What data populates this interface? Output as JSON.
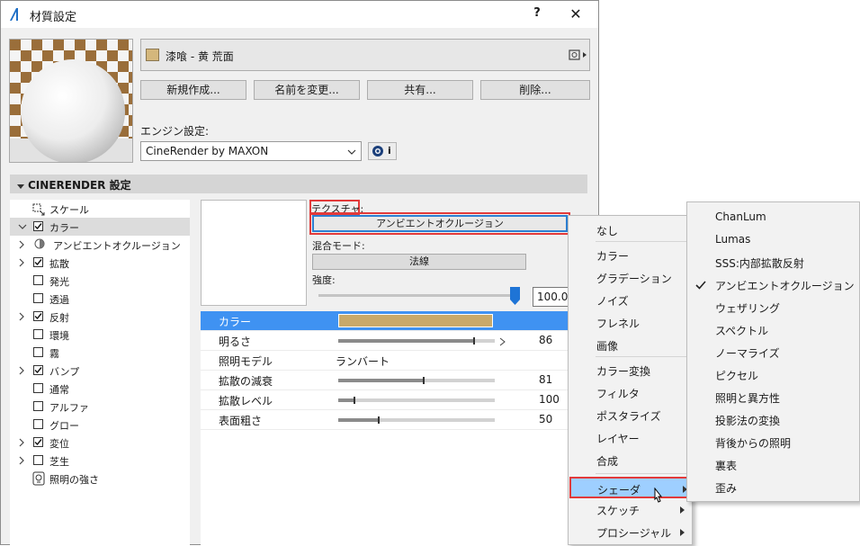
{
  "window": {
    "title": "材質設定",
    "help": "?",
    "close": "✕"
  },
  "material": {
    "name": "漆喰 - 黄 荒面",
    "swatch_color": "#d4b77c"
  },
  "buttons": {
    "new": "新規作成...",
    "rename": "名前を変更...",
    "share": "共有...",
    "delete": "削除..."
  },
  "engine": {
    "label": "エンジン設定:",
    "value": "CineRender by MAXON",
    "info": "i"
  },
  "section": {
    "title": "CINERENDER 設定"
  },
  "channels": [
    {
      "label": "スケール",
      "kind": "scale-icon"
    },
    {
      "label": "カラー",
      "kind": "checkbox",
      "checked": true,
      "expand": "open"
    },
    {
      "label": "アンビエントオクルージョン",
      "kind": "radio",
      "expand": "closed"
    },
    {
      "label": "拡散",
      "kind": "checkbox",
      "checked": true,
      "expand": "closed"
    },
    {
      "label": "発光",
      "kind": "checkbox",
      "checked": false
    },
    {
      "label": "透過",
      "kind": "checkbox",
      "checked": false
    },
    {
      "label": "反射",
      "kind": "checkbox",
      "checked": true,
      "expand": "closed"
    },
    {
      "label": "環境",
      "kind": "checkbox",
      "checked": false
    },
    {
      "label": "霧",
      "kind": "checkbox",
      "checked": false
    },
    {
      "label": "バンプ",
      "kind": "checkbox",
      "checked": true,
      "expand": "closed"
    },
    {
      "label": "通常",
      "kind": "checkbox",
      "checked": false
    },
    {
      "label": "アルファ",
      "kind": "checkbox",
      "checked": false
    },
    {
      "label": "グロー",
      "kind": "checkbox",
      "checked": false
    },
    {
      "label": "変位",
      "kind": "checkbox",
      "checked": true,
      "expand": "closed"
    },
    {
      "label": "芝生",
      "kind": "checkbox",
      "checked": false,
      "expand": "closed"
    },
    {
      "label": "照明の強さ",
      "kind": "light-icon"
    }
  ],
  "texture": {
    "label": "テクスチャ:",
    "value": "アンビエントオクルージョン"
  },
  "blend": {
    "label": "混合モード:",
    "value": "法線"
  },
  "strength": {
    "label": "強度:",
    "value": "100.00",
    "level": 1.0
  },
  "properties": [
    {
      "name": "カラー",
      "type": "color",
      "color": "#c8a96a"
    },
    {
      "name": "明るさ",
      "type": "bar",
      "value": "86",
      "fraction": 0.86
    },
    {
      "name": "照明モデル",
      "type": "text",
      "text": "ランバート"
    },
    {
      "name": "拡散の減衰",
      "type": "bar",
      "value": "81",
      "fraction": 0.54
    },
    {
      "name": "拡散レベル",
      "type": "bar",
      "value": "100",
      "fraction": 0.1
    },
    {
      "name": "表面粗さ",
      "type": "bar",
      "value": "50",
      "fraction": 0.25
    }
  ],
  "menu_main": {
    "items": [
      {
        "label": "なし"
      },
      {
        "label": "カラー"
      },
      {
        "label": "グラデーション"
      },
      {
        "label": "ノイズ"
      },
      {
        "label": "フレネル"
      },
      {
        "label": "画像"
      },
      {
        "label": "カラー変換"
      },
      {
        "label": "フィルタ"
      },
      {
        "label": "ポスタライズ"
      },
      {
        "label": "レイヤー"
      },
      {
        "label": "合成"
      },
      {
        "label": "シェーダ",
        "submenu": true,
        "highlighted": true
      },
      {
        "label": "スケッチ",
        "submenu": true
      },
      {
        "label": "プロシージャル",
        "submenu": true
      }
    ]
  },
  "menu_sub": {
    "items": [
      {
        "label": "ChanLum"
      },
      {
        "label": "Lumas"
      },
      {
        "label": "SSS:内部拡散反射"
      },
      {
        "label": "アンビエントオクルージョン",
        "checked": true
      },
      {
        "label": "ウェザリング"
      },
      {
        "label": "スペクトル"
      },
      {
        "label": "ノーマライズ"
      },
      {
        "label": "ピクセル"
      },
      {
        "label": "照明と異方性"
      },
      {
        "label": "投影法の変換"
      },
      {
        "label": "背後からの照明"
      },
      {
        "label": "裏表"
      },
      {
        "label": "歪み"
      }
    ]
  }
}
